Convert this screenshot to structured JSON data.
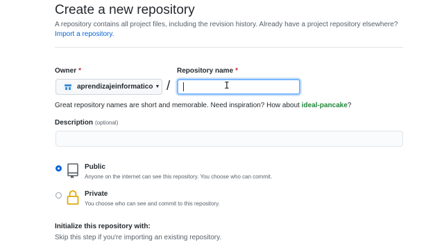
{
  "page": {
    "title": "Create a new repository",
    "subtitle": "A repository contains all project files, including the revision history. Already have a project repository elsewhere?",
    "import_link": "Import a repository."
  },
  "owner": {
    "label": "Owner",
    "required_mark": "*",
    "selected": "aprendizajeinformatico",
    "avatar_icon": "identicon"
  },
  "repo_name": {
    "label": "Repository name",
    "required_mark": "*",
    "value": "",
    "slash": "/"
  },
  "hint": {
    "text": "Great repository names are short and memorable. Need inspiration? How about ",
    "suggestion": "ideal-pancake",
    "end": "?"
  },
  "description": {
    "label": "Description",
    "optional": "(optional)",
    "value": ""
  },
  "visibility": {
    "options": [
      {
        "title": "Public",
        "desc": "Anyone on the internet can see this repository. You choose who can commit.",
        "checked": true,
        "icon": "repo-icon"
      },
      {
        "title": "Private",
        "desc": "You choose who can see and commit to this repository.",
        "checked": false,
        "icon": "lock-icon"
      }
    ]
  },
  "init": {
    "title": "Initialize this repository with:",
    "desc": "Skip this step if you're importing an existing repository."
  },
  "colors": {
    "link": "#0366d6",
    "suggestion": "#22863a",
    "required": "#cb2431",
    "focus_border": "#79b8ff",
    "lock": "#dbab09"
  }
}
